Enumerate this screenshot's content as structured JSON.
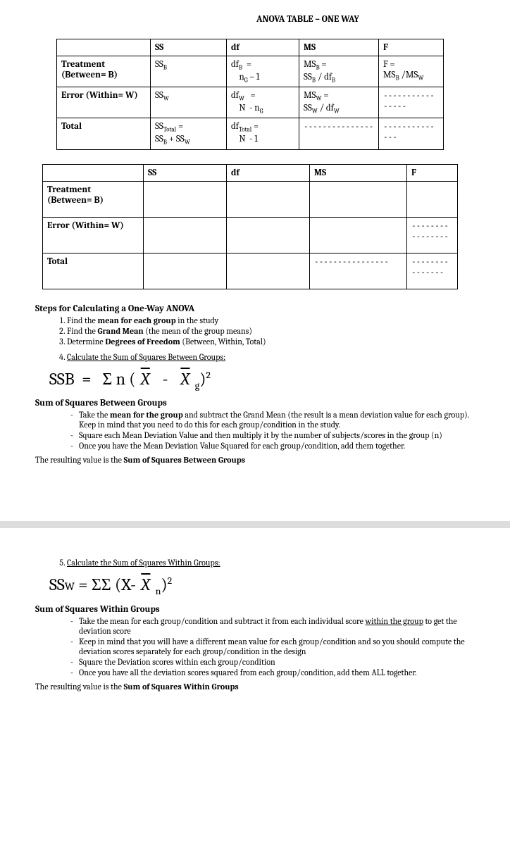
{
  "title": "ANOVA TABLE – ONE WAY",
  "table1": {
    "headers": [
      "",
      "SS",
      "df",
      "MS",
      "F"
    ],
    "rows": [
      {
        "label": "Treatment (Between= B)",
        "ss": "SS_B",
        "df_top": "df_B  =",
        "df_bot": "n_G – 1",
        "ms_top": "MS_B =",
        "ms_bot": "SS_B / df_B",
        "f_top": "F =",
        "f_bot": "MS_B /MS_W"
      },
      {
        "label": "Error (Within= W)",
        "ss": "SS_W",
        "df_top": "df_W   =",
        "df_bot": "N  - n_G",
        "ms_top": "MS_W =",
        "ms_bot": "SS_W / df_W",
        "f": "----------------"
      },
      {
        "label": "Total",
        "ss_top": "SS_Total =",
        "ss_bot": "SS_B + SS_W",
        "df_top": "df_Total =",
        "df_bot": "N  - 1",
        "ms": "---------------",
        "f": "--------------"
      }
    ]
  },
  "table2": {
    "headers": [
      "",
      "SS",
      "df",
      "MS",
      "F"
    ],
    "rows": [
      {
        "label": "Treatment (Between= B)",
        "f_dash": false,
        "ms_dash": false
      },
      {
        "label": "Error (Within= W)",
        "f_dash": true,
        "ms_dash": false
      },
      {
        "label": "Total",
        "f_dash": true,
        "ms_dash": true
      }
    ]
  },
  "steps_title": "Steps for Calculating a One-Way ANOVA",
  "steps": [
    {
      "pre": "Find the ",
      "bold": "mean for each group",
      "post": " in the study"
    },
    {
      "pre": "Find the ",
      "bold": "Grand Mean",
      "post": " (the mean of the group means)"
    },
    {
      "pre": "Determine ",
      "bold": "Degrees of Freedom",
      "post": " (Between, Within, Total)"
    }
  ],
  "step4": "Calculate the Sum of Squares Between Groups:",
  "formula_ssb": "SSB  =   Σ n ( X̄   -   X̄ g)²",
  "ssb_head": "Sum of Squares Between Groups",
  "ssb_bullets": [
    {
      "pre": "Take the ",
      "bold": "mean for the group",
      "post": " and subtract the Grand Mean (the result is a mean deviation value for each group). Keep in mind that you need to do this for each group/condition in the study."
    },
    {
      "text": "Square each Mean Deviation Value  and then multiply it by the number of subjects/scores in the group (n)"
    },
    {
      "text": "Once you have the Mean Deviation Value Squared for each group/condition, add them together."
    }
  ],
  "ssb_result": "The resulting value is the ",
  "ssb_result_bold": "Sum of Squares Between Groups",
  "step5": "Calculate the Sum of Squares Within Groups:",
  "formula_ssw": "SSW = ΣΣ (X- X̄ n)²",
  "ssw_head": "Sum of Squares Within Groups",
  "ssw_bullets": [
    {
      "pre": "Take the mean for each group/condition and subtract it from each individual score ",
      "u": "within the group",
      "post": " to get the deviation score"
    },
    {
      "text": "Keep in mind that you will have a different mean value for each group/condition and so you should compute the deviation scores separately for each group/condition in the design"
    },
    {
      "text": "Square the Deviation scores within each group/condition"
    },
    {
      "text": "Once you have all the deviation scores squared from each group/condition, add them ALL together."
    }
  ],
  "ssw_result": "The resulting value is the ",
  "ssw_result_bold": "Sum of Squares Within Groups",
  "dashes_long": "----------------",
  "dashes_med": "---------------"
}
